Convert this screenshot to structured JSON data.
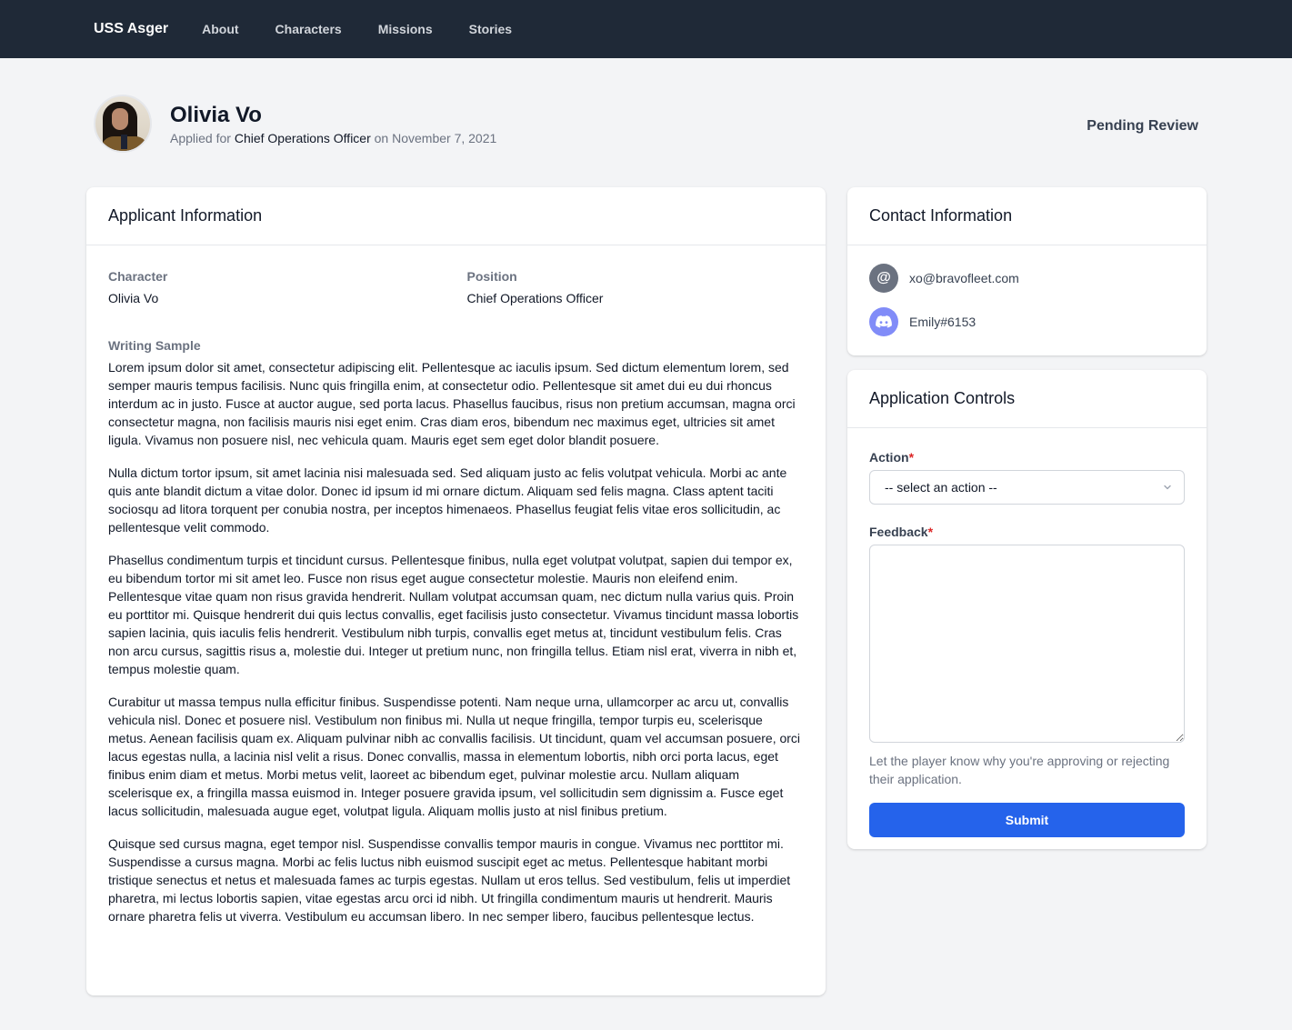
{
  "nav": {
    "brand": "USS Asger",
    "links": [
      "About",
      "Characters",
      "Missions",
      "Stories"
    ]
  },
  "header": {
    "name": "Olivia Vo",
    "applied_prefix": "Applied for",
    "position": "Chief Operations Officer",
    "date_prefix": "on",
    "date": "November 7, 2021",
    "status": "Pending Review"
  },
  "applicant_card": {
    "title": "Applicant Information",
    "character_label": "Character",
    "character_value": "Olivia Vo",
    "position_label": "Position",
    "position_value": "Chief Operations Officer",
    "writing_label": "Writing Sample",
    "paragraphs": [
      "Lorem ipsum dolor sit amet, consectetur adipiscing elit. Pellentesque ac iaculis ipsum. Sed dictum elementum lorem, sed semper mauris tempus facilisis. Nunc quis fringilla enim, at consectetur odio. Pellentesque sit amet dui eu dui rhoncus interdum ac in justo. Fusce at auctor augue, sed porta lacus. Phasellus faucibus, risus non pretium accumsan, magna orci consectetur magna, non facilisis mauris nisi eget enim. Cras diam eros, bibendum nec maximus eget, ultricies sit amet ligula. Vivamus non posuere nisl, nec vehicula quam. Mauris eget sem eget dolor blandit posuere.",
      "Nulla dictum tortor ipsum, sit amet lacinia nisi malesuada sed. Sed aliquam justo ac felis volutpat vehicula. Morbi ac ante quis ante blandit dictum a vitae dolor. Donec id ipsum id mi ornare dictum. Aliquam sed felis magna. Class aptent taciti sociosqu ad litora torquent per conubia nostra, per inceptos himenaeos. Phasellus feugiat felis vitae eros sollicitudin, ac pellentesque velit commodo.",
      "Phasellus condimentum turpis et tincidunt cursus. Pellentesque finibus, nulla eget volutpat volutpat, sapien dui tempor ex, eu bibendum tortor mi sit amet leo. Fusce non risus eget augue consectetur molestie. Mauris non eleifend enim. Pellentesque vitae quam non risus gravida hendrerit. Nullam volutpat accumsan quam, nec dictum nulla varius quis. Proin eu porttitor mi. Quisque hendrerit dui quis lectus convallis, eget facilisis justo consectetur. Vivamus tincidunt massa lobortis sapien lacinia, quis iaculis felis hendrerit. Vestibulum nibh turpis, convallis eget metus at, tincidunt vestibulum felis. Cras non arcu cursus, sagittis risus a, molestie dui. Integer ut pretium nunc, non fringilla tellus. Etiam nisl erat, viverra in nibh et, tempus molestie quam.",
      "Curabitur ut massa tempus nulla efficitur finibus. Suspendisse potenti. Nam neque urna, ullamcorper ac arcu ut, convallis vehicula nisl. Donec et posuere nisl. Vestibulum non finibus mi. Nulla ut neque fringilla, tempor turpis eu, scelerisque metus. Aenean facilisis quam ex. Aliquam pulvinar nibh ac convallis facilisis. Ut tincidunt, quam vel accumsan posuere, orci lacus egestas nulla, a lacinia nisl velit a risus. Donec convallis, massa in elementum lobortis, nibh orci porta lacus, eget finibus enim diam et metus. Morbi metus velit, laoreet ac bibendum eget, pulvinar molestie arcu. Nullam aliquam scelerisque ex, a fringilla massa euismod in. Integer posuere gravida ipsum, vel sollicitudin sem dignissim a. Fusce eget lacus sollicitudin, malesuada augue eget, volutpat ligula. Aliquam mollis justo at nisl finibus pretium.",
      "Quisque sed cursus magna, eget tempor nisl. Suspendisse convallis tempor mauris in congue. Vivamus nec porttitor mi. Suspendisse a cursus magna. Morbi ac felis luctus nibh euismod suscipit eget ac metus. Pellentesque habitant morbi tristique senectus et netus et malesuada fames ac turpis egestas. Nullam ut eros tellus. Sed vestibulum, felis ut imperdiet pharetra, mi lectus lobortis sapien, vitae egestas arcu orci id nibh. Ut fringilla condimentum mauris ut hendrerit. Mauris ornare pharetra felis ut viverra. Vestibulum eu accumsan libero. In nec semper libero, faucibus pellentesque lectus."
    ]
  },
  "contact_card": {
    "title": "Contact Information",
    "items": [
      {
        "icon": "at-sign-icon",
        "glyph": "@",
        "value": "xo@bravofleet.com"
      },
      {
        "icon": "discord-icon",
        "glyph": "",
        "value": "Emily#6153"
      }
    ]
  },
  "controls_card": {
    "title": "Application Controls",
    "action_label": "Action",
    "required_mark": "*",
    "action_selected": "-- select an action --",
    "feedback_label": "Feedback",
    "feedback_value": "",
    "help_text": "Let the player know why you're approving or rejecting their application.",
    "submit_label": "Submit"
  },
  "colors": {
    "nav_bg": "#1f2937",
    "page_bg": "#f3f4f6",
    "accent": "#2563eb",
    "required": "#dc2626",
    "discord": "#818cf8",
    "email_icon": "#6b7280"
  }
}
